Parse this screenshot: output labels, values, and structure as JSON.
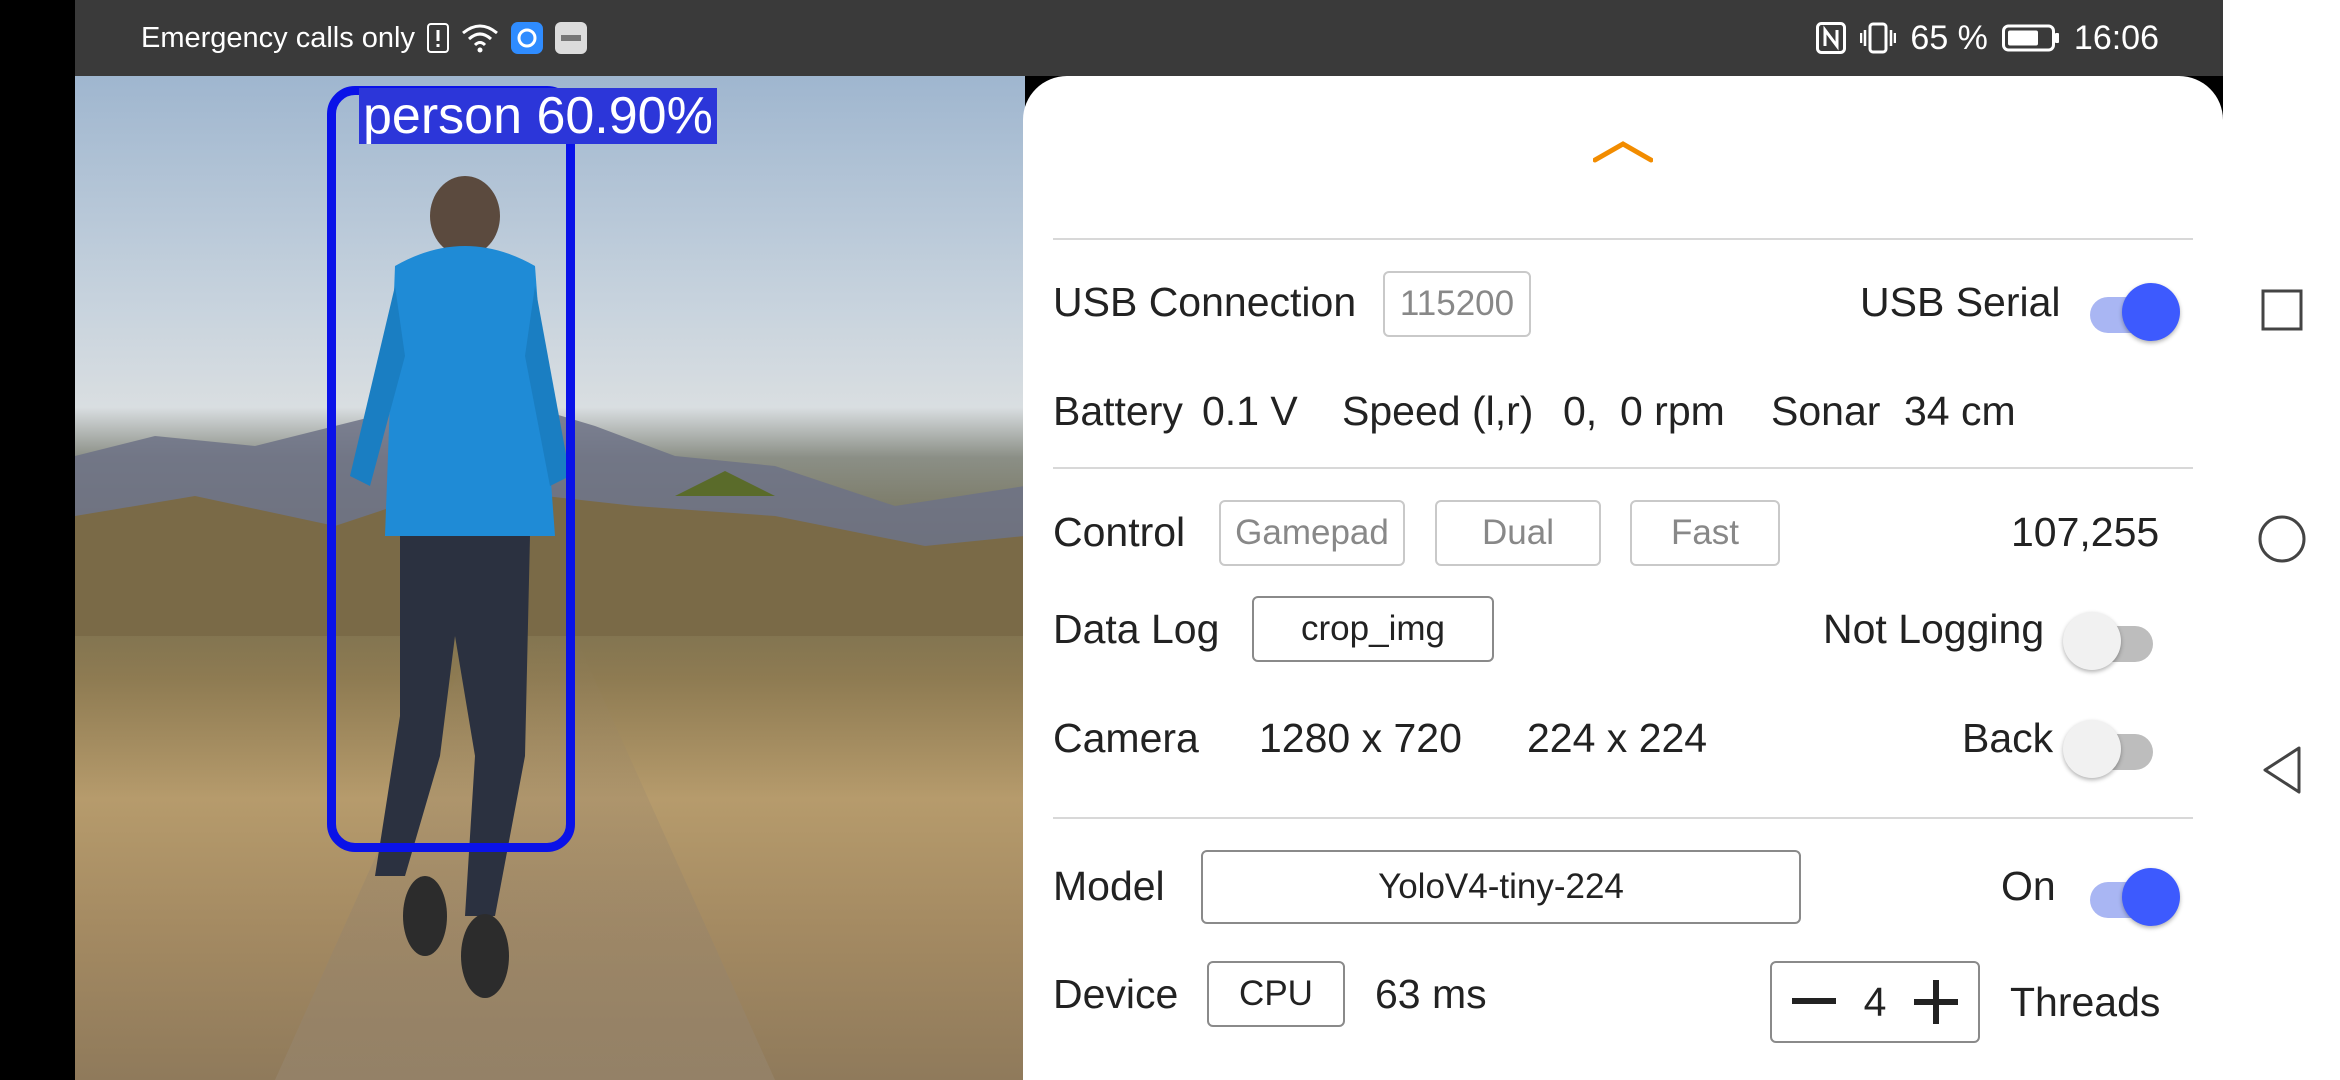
{
  "status_bar": {
    "carrier_text": "Emergency calls only",
    "battery_percent": "65 %",
    "time": "16:06"
  },
  "preview": {
    "detection_label": "person 60.90%"
  },
  "panel": {
    "usb": {
      "label": "USB Connection",
      "baud_rate": "115200",
      "serial_label": "USB Serial",
      "serial_on": true
    },
    "telemetry": {
      "battery_label": "Battery",
      "battery_value": "0.1 V",
      "speed_label": "Speed (l,r)",
      "speed_value": "0,  0 rpm",
      "sonar_label": "Sonar",
      "sonar_value": "34 cm"
    },
    "control": {
      "label": "Control",
      "modes": [
        "Gamepad",
        "Dual",
        "Fast"
      ],
      "value": "107,255"
    },
    "data_log": {
      "label": "Data Log",
      "value": "crop_img",
      "status_label": "Not Logging",
      "logging_on": false
    },
    "camera": {
      "label": "Camera",
      "preview_resolution": "1280 x 720",
      "model_resolution": "224 x 224",
      "facing_label": "Back",
      "facing_switch_on": false
    },
    "model": {
      "label": "Model",
      "value": "YoloV4-tiny-224",
      "status_label": "On",
      "enabled": true
    },
    "device": {
      "label": "Device",
      "value": "CPU",
      "inference_time": "63 ms",
      "threads_value": "4",
      "threads_label": "Threads"
    }
  },
  "colors": {
    "accent": "#3d5afe",
    "accent_track": "#a9b6f3",
    "bbox": "#0a12e8",
    "handle": "#f28c00"
  }
}
